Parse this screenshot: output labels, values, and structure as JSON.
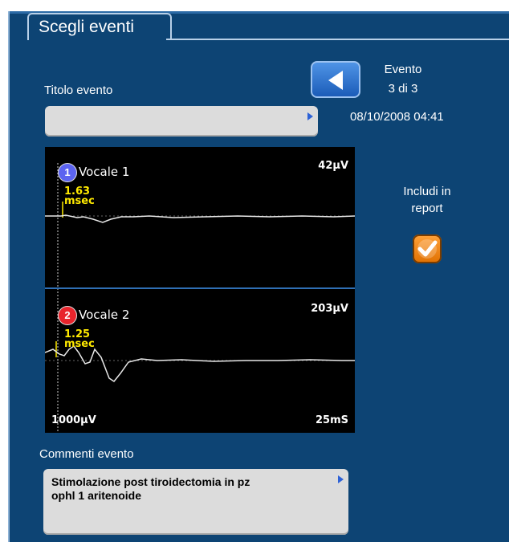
{
  "tab": {
    "label": "Scegli eventi"
  },
  "event": {
    "title_label": "Titolo evento",
    "title_value": "",
    "nav_label": "Evento",
    "counter": "3 di 3",
    "datetime": "08/10/2008 04:41"
  },
  "traces": [
    {
      "number": "1",
      "name": "Vocale 1",
      "amplitude": "42µV",
      "latency_value": "1.63",
      "latency_unit": "msec",
      "badge_color": "#5b63f0"
    },
    {
      "number": "2",
      "name": "Vocale 2",
      "amplitude": "203µV",
      "latency_value": "1.25",
      "latency_unit": "msec",
      "badge_color": "#e8242c"
    }
  ],
  "scale": {
    "vertical": "1000µV",
    "horizontal": "25mS"
  },
  "report": {
    "label_line1": "Includi in",
    "label_line2": "report",
    "checked": true
  },
  "comments": {
    "label": "Commenti evento",
    "line1": "Stimolazione post tiroidectomia in pz",
    "line2": "ophl 1 aritenoide"
  },
  "icons": {
    "back": "back-arrow-icon",
    "field_arrow": "triangle-right-icon",
    "check": "checkmark-icon"
  }
}
